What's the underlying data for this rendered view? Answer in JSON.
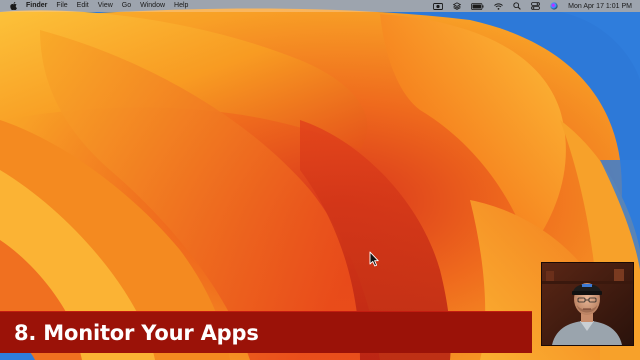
{
  "menubar": {
    "app_name": "Finder",
    "menus": [
      "File",
      "Edit",
      "View",
      "Go",
      "Window",
      "Help"
    ],
    "status_icons": [
      "screen-record-icon",
      "layers-icon",
      "battery-icon",
      "wifi-icon",
      "search-icon",
      "control-center-icon",
      "siri-icon"
    ],
    "clock": "Mon Apr 17  1:01 PM"
  },
  "banner": {
    "title": "8. Monitor Your Apps",
    "color": "#9b1208"
  },
  "webcam": {
    "description_icon": "presenter-webcam"
  },
  "colors": {
    "wallpaper_orange": "#f7941d",
    "wallpaper_deep": "#d2341a",
    "wallpaper_blue": "#1f6fd6"
  }
}
